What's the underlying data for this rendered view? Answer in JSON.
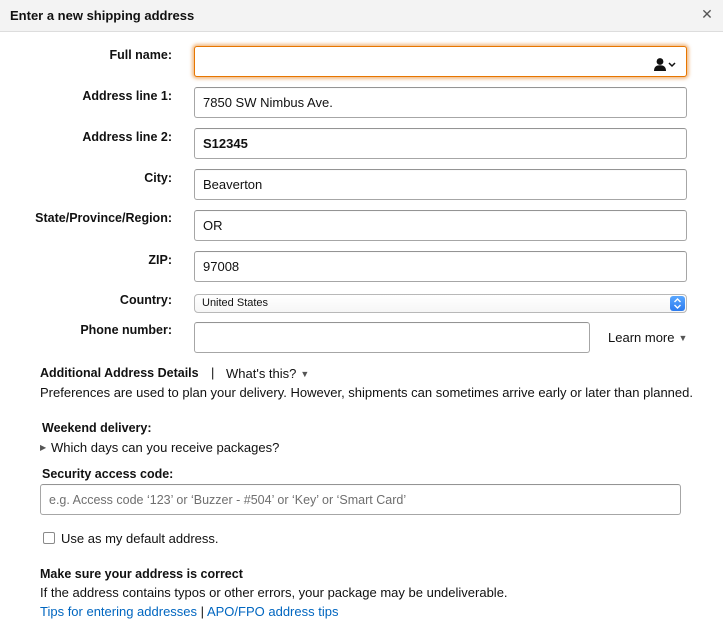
{
  "header": {
    "title": "Enter a new shipping address"
  },
  "form": {
    "full_name": {
      "label": "Full name:",
      "value": ""
    },
    "address1": {
      "label": "Address line 1:",
      "value": "7850 SW Nimbus Ave."
    },
    "address2": {
      "label": "Address line 2:",
      "value": "S12345"
    },
    "city": {
      "label": "City:",
      "value": "Beaverton"
    },
    "state": {
      "label": "State/Province/Region:",
      "value": "OR"
    },
    "zip": {
      "label": "ZIP:",
      "value": "97008"
    },
    "country": {
      "label": "Country:",
      "value": "United States"
    },
    "phone": {
      "label": "Phone number:",
      "value": "",
      "learn_more": "Learn more"
    }
  },
  "additional": {
    "title": "Additional Address Details",
    "separator": "|",
    "whats_this": "What's this?",
    "description": "Preferences are used to plan your delivery. However, shipments can sometimes arrive early or later than planned."
  },
  "weekend": {
    "title": "Weekend delivery:",
    "link": "Which days can you receive packages?"
  },
  "security": {
    "title": "Security access code:",
    "placeholder": "e.g. Access code ‘123’ or ‘Buzzer - #504’ or ‘Key’ or ‘Smart Card’"
  },
  "default_address": {
    "label": "Use as my default address."
  },
  "correct": {
    "title": "Make sure your address is correct",
    "text": "If the address contains typos or other errors, your package may be undeliverable.",
    "tips_link": "Tips for entering addresses",
    "separator": "|",
    "apo_link": "APO/FPO address tips"
  }
}
